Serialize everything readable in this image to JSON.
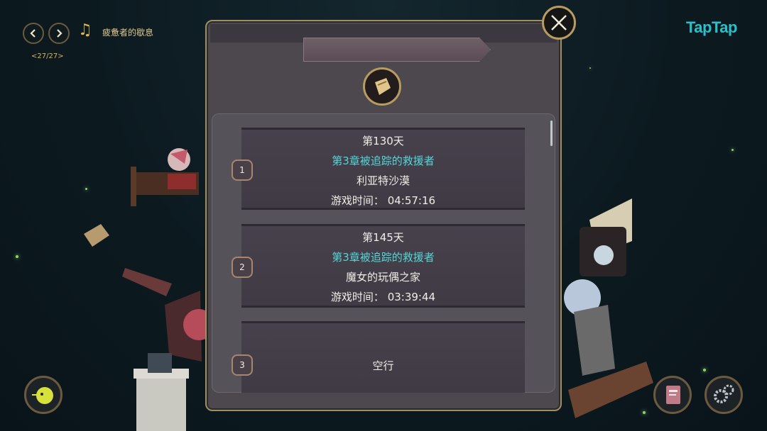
{
  "music": {
    "prev_icon": "chevron-left-icon",
    "next_icon": "chevron-right-icon",
    "note_icon": "music-note-icon",
    "title": "疲惫者的歇息",
    "count": "<27/27>"
  },
  "brand": "TapTap",
  "save_slots": [
    {
      "index": "1",
      "day": "第130天",
      "chapter": "第3章被追踪的救援者",
      "location": "利亚特沙漠",
      "playtime": "游戏时间： 04:57:16"
    },
    {
      "index": "2",
      "day": "第145天",
      "chapter": "第3章被追踪的救援者",
      "location": "魔女的玩偶之家",
      "playtime": "游戏时间： 03:39:44"
    },
    {
      "index": "3",
      "empty_label": "空行"
    }
  ],
  "colors": {
    "chapter_text": "#54d6d8",
    "frame_gold": "#b89b60",
    "brand": "#29c1c9"
  }
}
